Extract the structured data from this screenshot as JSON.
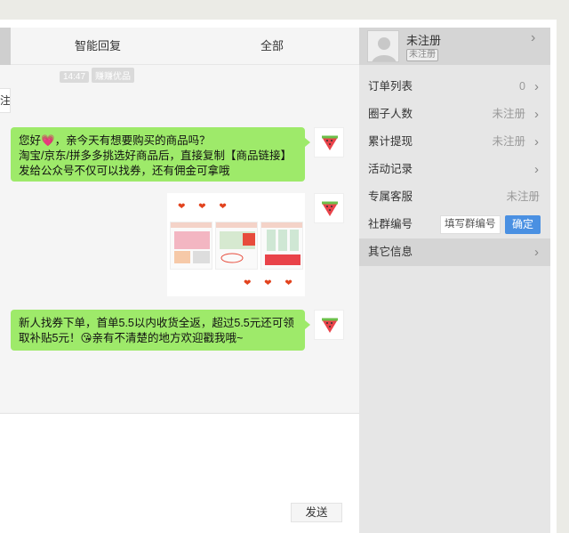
{
  "tabs": {
    "smart_reply": "智能回复",
    "all": "全部"
  },
  "chat": {
    "timestamp": "14:47",
    "sender_tag": "赚赚优品",
    "edge_text": "注",
    "messages": [
      {
        "text": "您好💗，亲今天有想要购买的商品吗？\n淘宝/京东/拼多多挑选好商品后，直接复制【商品链接】发给公众号不仅可以找券，还有佣金可拿哦"
      },
      {
        "text": "新人找券下单，首单5.5以内收货全返，超过5.5元还可领取补贴5元！😘亲有不清楚的地方欢迎戳我哦~"
      }
    ],
    "image_hearts_top": "❤ ❤ ❤",
    "image_hearts_bottom": "❤ ❤ ❤"
  },
  "input": {
    "send_label": "发送"
  },
  "sidebar": {
    "profile_name": "未注册",
    "profile_tag": "未注册",
    "rows": [
      {
        "label": "订单列表",
        "value": "0",
        "chevron": true
      },
      {
        "label": "圈子人数",
        "value": "未注册",
        "chevron": true
      },
      {
        "label": "累计提现",
        "value": "未注册",
        "chevron": true
      },
      {
        "label": "活动记录",
        "value": "",
        "chevron": true
      },
      {
        "label": "专属客服",
        "value": "未注册",
        "chevron": false
      },
      {
        "label": "社群编号",
        "placeholder": "填写群编号",
        "button": "确定"
      },
      {
        "label": "其它信息",
        "value": "",
        "chevron": true
      }
    ]
  },
  "colors": {
    "bubble": "#9eea6a",
    "accent_button": "#4a90e2"
  }
}
